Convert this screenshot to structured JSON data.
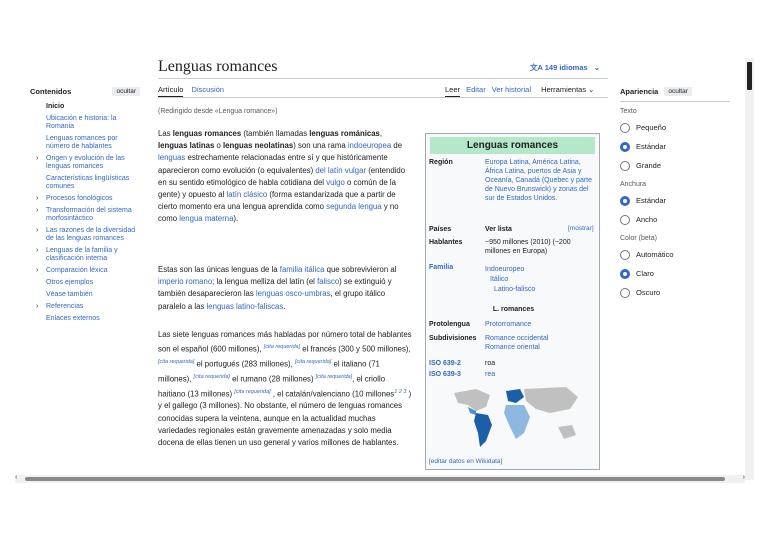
{
  "toc": {
    "title": "Contenidos",
    "hide": "ocultar",
    "items": [
      {
        "label": "Inicio",
        "active": true
      },
      {
        "label": "Ubicación e historia: la Romania"
      },
      {
        "label": "Lenguas romances por número de hablantes"
      },
      {
        "label": "Origen y evolución de las lenguas romances",
        "chev": true
      },
      {
        "label": "Características lingüísticas comunes"
      },
      {
        "label": "Procesos fonológicos",
        "chev": true
      },
      {
        "label": "Transformación del sistema morfosintáctico",
        "chev": true
      },
      {
        "label": "Las razones de la diversidad de las lenguas romances",
        "chev": true
      },
      {
        "label": "Lenguas de la familia y clasificación interna",
        "chev": true
      },
      {
        "label": "Comparación léxica",
        "chev": true
      },
      {
        "label": "Otros ejemplos"
      },
      {
        "label": "Véase también"
      },
      {
        "label": "Referencias",
        "chev": true
      },
      {
        "label": "Enlaces externos"
      }
    ]
  },
  "header": {
    "title": "Lenguas romances",
    "languages": "149 idiomas",
    "tab_article": "Artículo",
    "tab_talk": "Discusión",
    "read": "Leer",
    "edit": "Editar",
    "history": "Ver historial",
    "tools": "Herramientas"
  },
  "body": {
    "redirect": "(Redirigido desde «Lengua romance»)",
    "cite_needed": "cita requerida"
  },
  "infobox": {
    "title": "Lenguas romances",
    "region_label": "Región",
    "region": "Europa Latina, América Latina, África Latina, puertos de Asia y Oceanía, Canadá (Quebec y parte de Nuevo Brunswick) y zonas del sur de Estados Unidos.",
    "countries_label": "Países",
    "countries": "Ver lista",
    "show": "[mostrar]",
    "speakers_label": "Hablantes",
    "speakers": "~950 millones (2010) (~200 millones en Europa)",
    "family_label": "Familia",
    "family": [
      "Indoeuropeo",
      "Itálico",
      "Latino-falisco"
    ],
    "subheader": "L. romances",
    "proto_label": "Protolengua",
    "proto": "Protorromance",
    "subdiv_label": "Subdivisiones",
    "subdiv": [
      "Romance occidental",
      "Romance oriental"
    ],
    "iso2_label": "ISO 639-2",
    "iso2": "roa",
    "iso3_label": "ISO 639-3",
    "iso3": "rea",
    "footer": "[editar datos en Wikidata]"
  },
  "appearance": {
    "title": "Apariencia",
    "hide": "ocultar",
    "text_label": "Texto",
    "text_options": [
      "Pequeño",
      "Estándar",
      "Grande"
    ],
    "text_selected": 1,
    "width_label": "Anchura",
    "width_options": [
      "Estándar",
      "Ancho"
    ],
    "width_selected": 0,
    "color_label": "Color (beta)",
    "color_options": [
      "Automático",
      "Claro",
      "Oscuro"
    ],
    "color_selected": 1
  },
  "colors": {
    "link": "#3366cc",
    "infobox_header": "#b4e8c8",
    "radio_on": "#3366cc"
  }
}
